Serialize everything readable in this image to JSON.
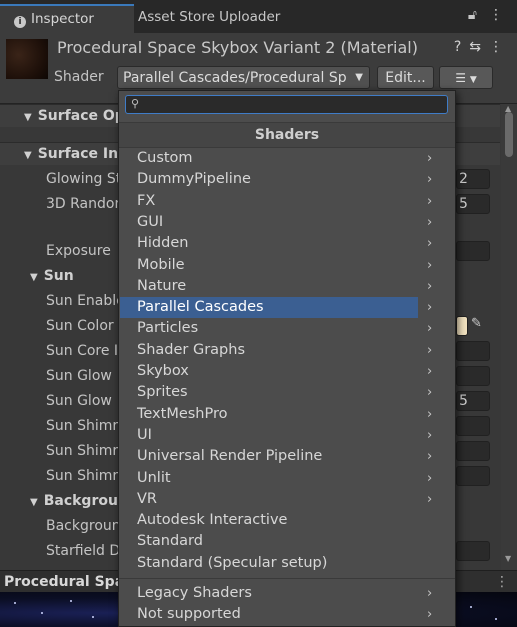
{
  "tabs": {
    "inspector": "Inspector",
    "uploader": "Asset Store Uploader"
  },
  "header": {
    "title": "Procedural Space Skybox Variant 2 (Material)",
    "shader_label": "Shader",
    "shader_value": "Parallel Cascades/Procedural Sp",
    "edit_label": "Edit...",
    "help_icon": "?",
    "preset_icon": "⇆",
    "menu_icon": "⋮"
  },
  "properties": [
    {
      "label": "Surface Op",
      "type": "section"
    },
    {
      "label": "Surface Inp",
      "type": "section"
    },
    {
      "label": "Glowing St",
      "type": "field",
      "value": "2"
    },
    {
      "label": "3D Randor",
      "type": "field",
      "value": "5"
    },
    {
      "label": "Exposure",
      "type": "field",
      "value": ""
    },
    {
      "label": "Sun",
      "type": "subsection"
    },
    {
      "label": "Sun Enable",
      "type": "label"
    },
    {
      "label": "Sun Color",
      "type": "color"
    },
    {
      "label": "Sun Core I",
      "type": "field",
      "value": ""
    },
    {
      "label": "Sun Glow",
      "type": "field",
      "value": ""
    },
    {
      "label": "Sun Glow",
      "type": "field",
      "value": "5"
    },
    {
      "label": "Sun Shimr",
      "type": "field",
      "value": ""
    },
    {
      "label": "Sun Shimr",
      "type": "field",
      "value": ""
    },
    {
      "label": "Sun Shimr",
      "type": "field",
      "value": ""
    },
    {
      "label": "Backgroun",
      "type": "subsection"
    },
    {
      "label": "Backgroun",
      "type": "label"
    },
    {
      "label": "Starfield D",
      "type": "field",
      "value": ""
    }
  ],
  "preview_label": "Procedural Spac",
  "dropdown": {
    "search_placeholder": "",
    "header": "Shaders",
    "items": [
      {
        "label": "Custom",
        "submenu": true
      },
      {
        "label": "DummyPipeline",
        "submenu": true
      },
      {
        "label": "FX",
        "submenu": true
      },
      {
        "label": "GUI",
        "submenu": true
      },
      {
        "label": "Hidden",
        "submenu": true
      },
      {
        "label": "Mobile",
        "submenu": true
      },
      {
        "label": "Nature",
        "submenu": true
      },
      {
        "label": "Parallel Cascades",
        "submenu": true,
        "selected": true
      },
      {
        "label": "Particles",
        "submenu": true
      },
      {
        "label": "Shader Graphs",
        "submenu": true
      },
      {
        "label": "Skybox",
        "submenu": true
      },
      {
        "label": "Sprites",
        "submenu": true
      },
      {
        "label": "TextMeshPro",
        "submenu": true
      },
      {
        "label": "UI",
        "submenu": true
      },
      {
        "label": "Universal Render Pipeline",
        "submenu": true
      },
      {
        "label": "Unlit",
        "submenu": true
      },
      {
        "label": "VR",
        "submenu": true
      },
      {
        "label": "Autodesk Interactive",
        "submenu": false
      },
      {
        "label": "Standard",
        "submenu": false
      },
      {
        "label": "Standard (Specular setup)",
        "submenu": false
      },
      {
        "label": "Legacy Shaders",
        "submenu": true
      },
      {
        "label": "Not supported",
        "submenu": true
      }
    ]
  },
  "colors": {
    "accent": "#3a79bb",
    "selection": "#3b5f92",
    "sun_color": "#f3e3c0"
  }
}
